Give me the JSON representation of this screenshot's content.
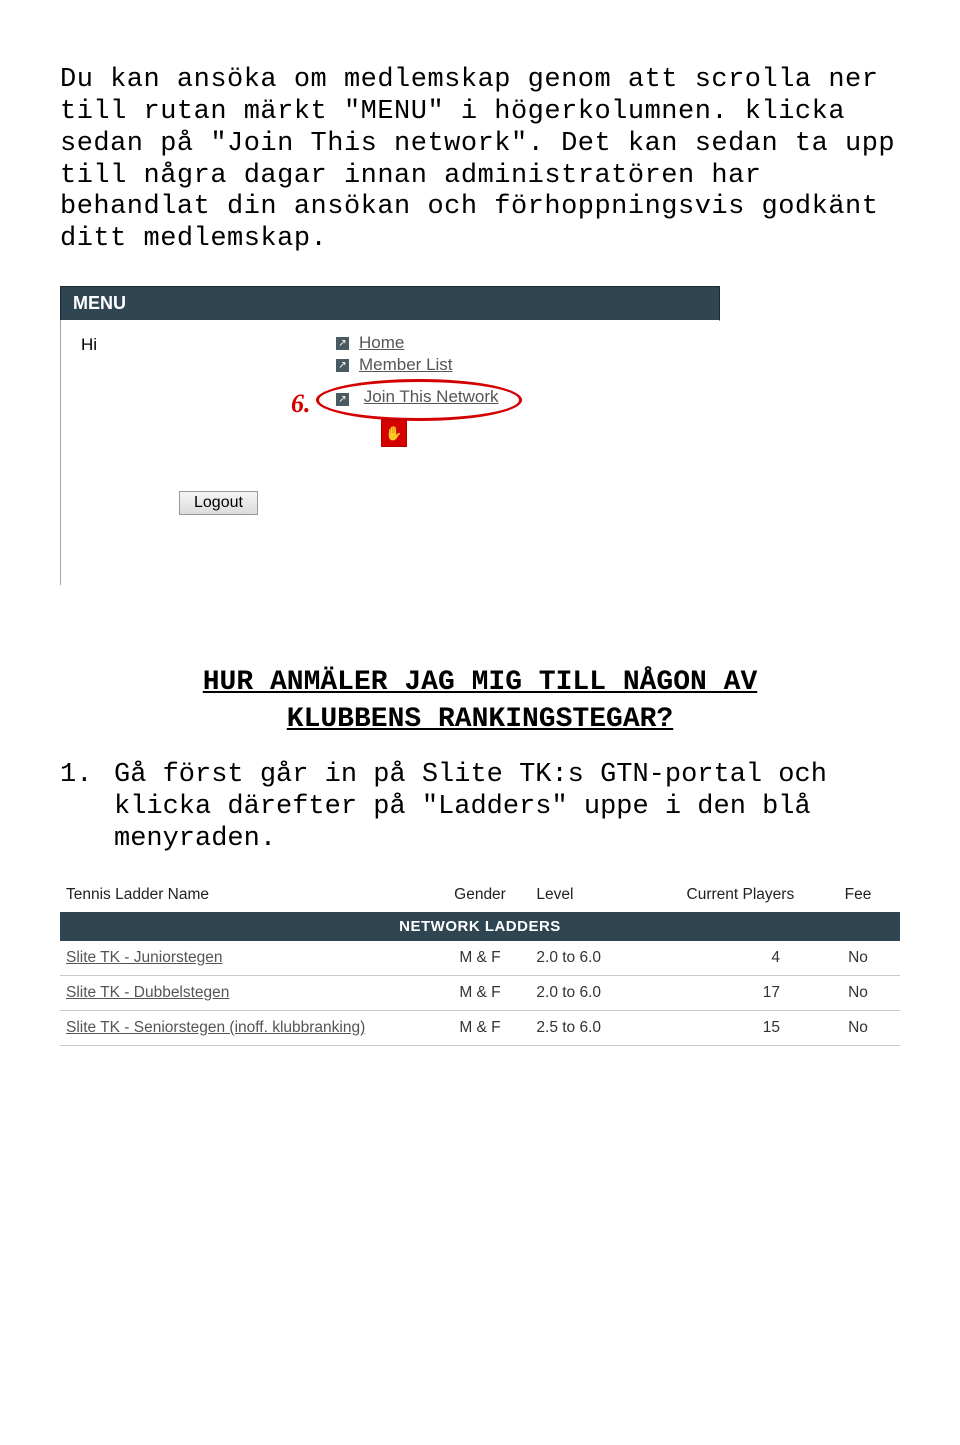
{
  "intro_text": "Du kan ansöka om medlemskap genom att scrolla ner till rutan märkt \"MENU\" i högerkolumnen. klicka sedan på \"Join This network\". Det kan sedan ta upp till några dagar innan administratören har behandlat din ansökan och förhoppningsvis godkänt ditt medlemskap.",
  "menu_shot": {
    "header": "MENU",
    "hi": "Hi",
    "links": {
      "home": "Home",
      "member_list": "Member List",
      "join": "Join This Network"
    },
    "step_number": "6.",
    "logout": "Logout"
  },
  "section_heading_line1": "HUR ANMÄLER JAG MIG TILL NÅGON AV",
  "section_heading_line2": "KLUBBENS RANKINGSTEGAR?",
  "step1": {
    "num": "1.",
    "text": "Gå först går in på Slite TK:s GTN-portal och klicka därefter på \"Ladders\" uppe i den blå menyraden."
  },
  "ladders": {
    "headers": {
      "name": "Tennis Ladder Name",
      "gender": "Gender",
      "level": "Level",
      "players": "Current Players",
      "fee": "Fee"
    },
    "section_title": "NETWORK LADDERS",
    "rows": [
      {
        "name": "Slite TK - Juniorstegen",
        "gender": "M & F",
        "level": "2.0 to 6.0",
        "players": "4",
        "fee": "No"
      },
      {
        "name": "Slite TK - Dubbelstegen",
        "gender": "M & F",
        "level": "2.0 to 6.0",
        "players": "17",
        "fee": "No"
      },
      {
        "name": "Slite TK - Seniorstegen (inoff. klubbranking)",
        "gender": "M & F",
        "level": "2.5 to 6.0",
        "players": "15",
        "fee": "No"
      }
    ]
  }
}
